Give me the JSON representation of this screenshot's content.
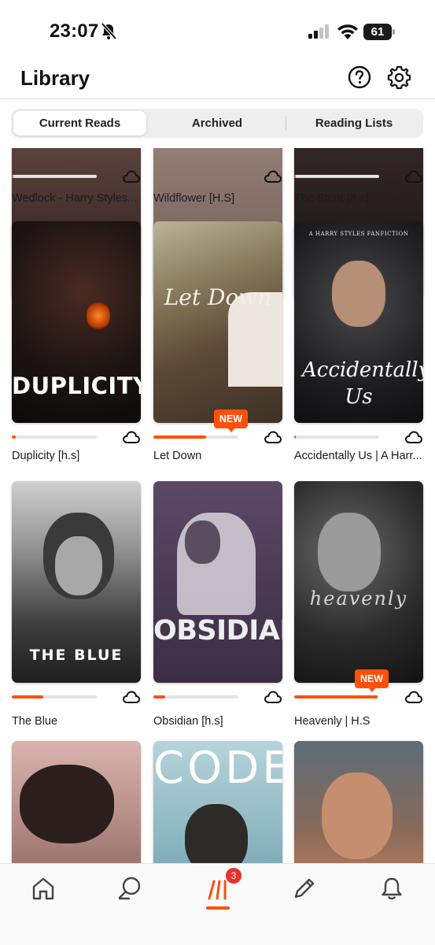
{
  "status_bar": {
    "time": "23:07",
    "battery": "61",
    "battery_level": 0.61
  },
  "header": {
    "title": "Library"
  },
  "tabs": [
    {
      "label": "Current Reads",
      "selected": true
    },
    {
      "label": "Archived",
      "selected": false
    },
    {
      "label": "Reading Lists",
      "selected": false
    }
  ],
  "books": [
    {
      "title": "Wedlock - Harry Styles...",
      "progress": 0.01,
      "cover_text": "",
      "new": false
    },
    {
      "title": "Wildflower [H.S]",
      "progress": 0.0,
      "cover_text": "",
      "new": false
    },
    {
      "title": "The Stunt [h.s]",
      "progress": 0.02,
      "cover_text": "",
      "new": false
    },
    {
      "title": "Duplicity [h.s]",
      "progress": 0.05,
      "cover_text": "DUPLICITY",
      "new": false
    },
    {
      "title": "Let Down",
      "progress": 0.62,
      "cover_text": "Let Down",
      "new": true
    },
    {
      "title": "Accidentally Us | A Harr...",
      "progress": 0.01,
      "cover_text": "Accidentally Us",
      "cover_subtext": "A HARRY STYLES FANFICTION",
      "new": false
    },
    {
      "title": "The Blue",
      "progress": 0.37,
      "cover_text": "THE BLUE",
      "new": false
    },
    {
      "title": "Obsidian [h.s]",
      "progress": 0.14,
      "cover_text": "OBSIDIAN",
      "new": false
    },
    {
      "title": "Heavenly | H.S",
      "progress": 0.98,
      "cover_text": "heavenly",
      "new": true
    },
    {
      "title": "",
      "progress": 0.0,
      "cover_text": "",
      "new": false
    },
    {
      "title": "",
      "progress": 0.0,
      "cover_text": "CODE",
      "new": false
    },
    {
      "title": "",
      "progress": 0.0,
      "cover_text": "",
      "new": false
    }
  ],
  "new_badge_label": "NEW",
  "bottom_nav": {
    "items": [
      {
        "name": "home-icon"
      },
      {
        "name": "search-icon"
      },
      {
        "name": "library-icon",
        "badge": "3",
        "selected": true
      },
      {
        "name": "pencil-icon"
      },
      {
        "name": "notifications-icon"
      }
    ]
  },
  "colors": {
    "accent": "#ff500a",
    "badge": "#e8322d"
  }
}
